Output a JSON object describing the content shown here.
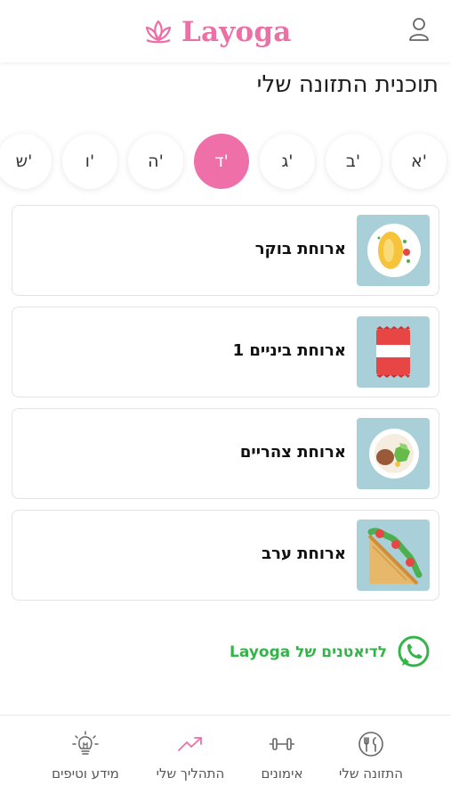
{
  "header": {
    "brand": "Layoga",
    "accent": "#ec6fa6"
  },
  "page": {
    "title": "תוכנית התזונה שלי"
  },
  "days": [
    {
      "label": "א'",
      "active": false
    },
    {
      "label": "ב'",
      "active": false
    },
    {
      "label": "ג'",
      "active": false
    },
    {
      "label": "ד'",
      "active": true
    },
    {
      "label": "ה'",
      "active": false
    },
    {
      "label": "ו'",
      "active": false
    },
    {
      "label": "ש'",
      "active": false
    }
  ],
  "meals": [
    {
      "label": "ארוחת בוקר",
      "icon": "omelette-icon"
    },
    {
      "label": "ארוחת ביניים 1",
      "icon": "snack-bag-icon"
    },
    {
      "label": "ארוחת צהריים",
      "icon": "lunch-plate-icon"
    },
    {
      "label": "ארוחת ערב",
      "icon": "sandwich-icon"
    }
  ],
  "whatsapp": {
    "label": "לדיאטנים של Layoga",
    "color": "#35b44a"
  },
  "bottom_nav": [
    {
      "label": "התזונה שלי",
      "icon": "plate-cutlery-icon",
      "active": false
    },
    {
      "label": "אימונים",
      "icon": "dumbbell-icon",
      "active": false
    },
    {
      "label": "התהליך שלי",
      "icon": "trend-up-icon",
      "active": true
    },
    {
      "label": "מידע וטיפים",
      "icon": "lightbulb-icon",
      "active": false
    }
  ]
}
